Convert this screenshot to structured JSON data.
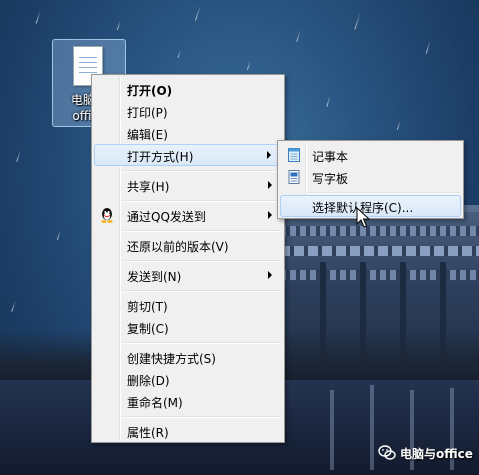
{
  "desktop": {
    "file_label": "电脑与\noffice"
  },
  "context_menu": {
    "items": [
      {
        "label": "打开(O)"
      },
      {
        "label": "打印(P)"
      },
      {
        "label": "编辑(E)"
      },
      {
        "label": "打开方式(H)"
      },
      {
        "label": "共享(H)"
      },
      {
        "label": "通过QQ发送到"
      },
      {
        "label": "还原以前的版本(V)"
      },
      {
        "label": "发送到(N)"
      },
      {
        "label": "剪切(T)"
      },
      {
        "label": "复制(C)"
      },
      {
        "label": "创建快捷方式(S)"
      },
      {
        "label": "删除(D)"
      },
      {
        "label": "重命名(M)"
      },
      {
        "label": "属性(R)"
      }
    ]
  },
  "submenu": {
    "items": [
      {
        "label": "记事本",
        "icon": "notepad-icon"
      },
      {
        "label": "写字板",
        "icon": "wordpad-icon"
      },
      {
        "label": "选择默认程序(C)..."
      }
    ]
  },
  "watermark": {
    "text": "电脑与office",
    "icon": "wechat-icon"
  },
  "colors": {
    "menu_bg": "#f0f0f0",
    "highlight_bg": "#d9e8f8",
    "highlight_border": "#aecff7"
  }
}
